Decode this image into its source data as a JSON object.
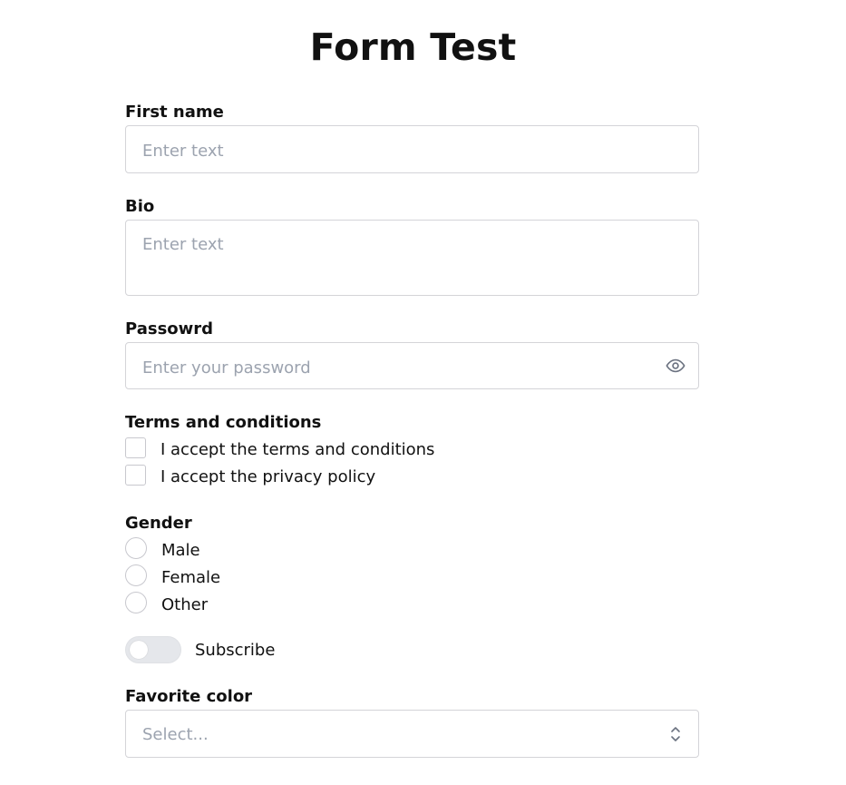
{
  "title": "Form Test",
  "first_name": {
    "label": "First name",
    "placeholder": "Enter text",
    "value": ""
  },
  "bio": {
    "label": "Bio",
    "placeholder": "Enter text",
    "value": ""
  },
  "password": {
    "label": "Passowrd",
    "placeholder": "Enter your password",
    "value": "",
    "toggle_icon": "eye-icon"
  },
  "terms": {
    "label": "Terms and conditions",
    "options": [
      {
        "label": "I accept the terms and conditions",
        "checked": false
      },
      {
        "label": "I accept the privacy policy",
        "checked": false
      }
    ]
  },
  "gender": {
    "label": "Gender",
    "options": [
      {
        "label": "Male",
        "selected": false
      },
      {
        "label": "Female",
        "selected": false
      },
      {
        "label": "Other",
        "selected": false
      }
    ]
  },
  "subscribe": {
    "label": "Subscribe",
    "on": false
  },
  "favorite_color": {
    "label": "Favorite color",
    "placeholder": "Select...",
    "icon": "chevron-up-down-icon"
  }
}
